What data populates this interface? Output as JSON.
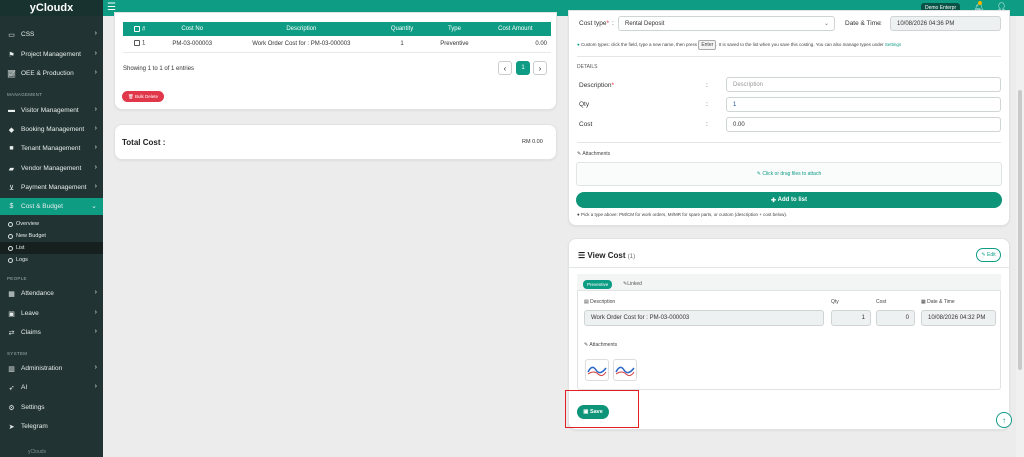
{
  "brand": "yCloudx",
  "topbar": {
    "user": "Demo Enterpr"
  },
  "sidebar": {
    "items": [
      {
        "label": "CSS",
        "icon": "monitor-icon"
      },
      {
        "label": "Project Management",
        "icon": "flag-icon"
      },
      {
        "label": "OEE & Production",
        "icon": "chart-icon"
      },
      {
        "label": "Visitor Management",
        "icon": "id-card-icon"
      },
      {
        "label": "Booking Management",
        "icon": "tag-icon"
      },
      {
        "label": "Tenant Management",
        "icon": "briefcase-icon"
      },
      {
        "label": "Vendor Management",
        "icon": "truck-icon"
      },
      {
        "label": "Payment Management",
        "icon": "cart-icon"
      },
      {
        "label": "Cost & Budget",
        "icon": "dollar-icon"
      },
      {
        "label": "Attendance",
        "icon": "calendar-icon"
      },
      {
        "label": "Leave",
        "icon": "suitcase-icon"
      },
      {
        "label": "Claims",
        "icon": "exchange-icon"
      },
      {
        "label": "Administration",
        "icon": "building-icon"
      },
      {
        "label": "AI",
        "icon": "rocket-icon"
      },
      {
        "label": "Settings",
        "icon": "gear-icon"
      },
      {
        "label": "Telegram",
        "icon": "telegram-icon"
      }
    ],
    "sub_items": [
      "Overview",
      "New Budget",
      "List",
      "Logs"
    ],
    "headings": {
      "management": "MANAGEMENT",
      "people": "PEOPLE",
      "system": "SYSTEM"
    },
    "footer": "yCloudx"
  },
  "table": {
    "headers": [
      "#",
      "Cost No",
      "Description",
      "Quantity",
      "Type",
      "Cost Amount"
    ],
    "rows": [
      [
        "1",
        "PM-03-000003",
        "Work Order Cost for : PM-03-000003",
        "1",
        "Preventive",
        "0.00"
      ]
    ],
    "showing": "Showing 1 to 1 of 1 entries",
    "page": "1",
    "bulk_delete": "Bulk Delete"
  },
  "total": {
    "label": "Total Cost :",
    "value": "RM 0.00"
  },
  "form": {
    "cost_type_label": "Cost type",
    "cost_type_value": "Rental Deposit",
    "datetime_label": "Date & Time",
    "datetime_value": "10/08/2026 04:36 PM",
    "help_1": "Custom types: click the field, type a new name, then press",
    "help_key": "Enter",
    "help_2": ". It is saved to the list when you save this costing. You can also manage types under",
    "help_link": "Settings",
    "details_head": "DETAILS",
    "description_label": "Description",
    "description_placeholder": "Description",
    "qty_label": "Qty",
    "qty_value": "1",
    "cost_label": "Cost",
    "cost_value": "0.00",
    "attachments_label": "Attachments",
    "dropzone": "Click or drag files to attach",
    "add_button": "Add to list",
    "hint": "Pick a type above: PM/CM for work orders, MI/MR for spare parts, or custom (description + cost below)."
  },
  "view_cost": {
    "title": "View Cost",
    "count": "(1)",
    "edit": "Edit",
    "tabs": [
      "Preventive",
      "Linked"
    ],
    "col_description": "Description",
    "col_qty": "Qty",
    "col_cost": "Cost",
    "col_datetime": "Date & Time",
    "row_description": "Work Order Cost for : PM-03-000003",
    "row_qty": "1",
    "row_cost": "0",
    "row_datetime": "10/08/2026 04:32 PM",
    "attachments_label": "Attachments",
    "save": "Save"
  }
}
